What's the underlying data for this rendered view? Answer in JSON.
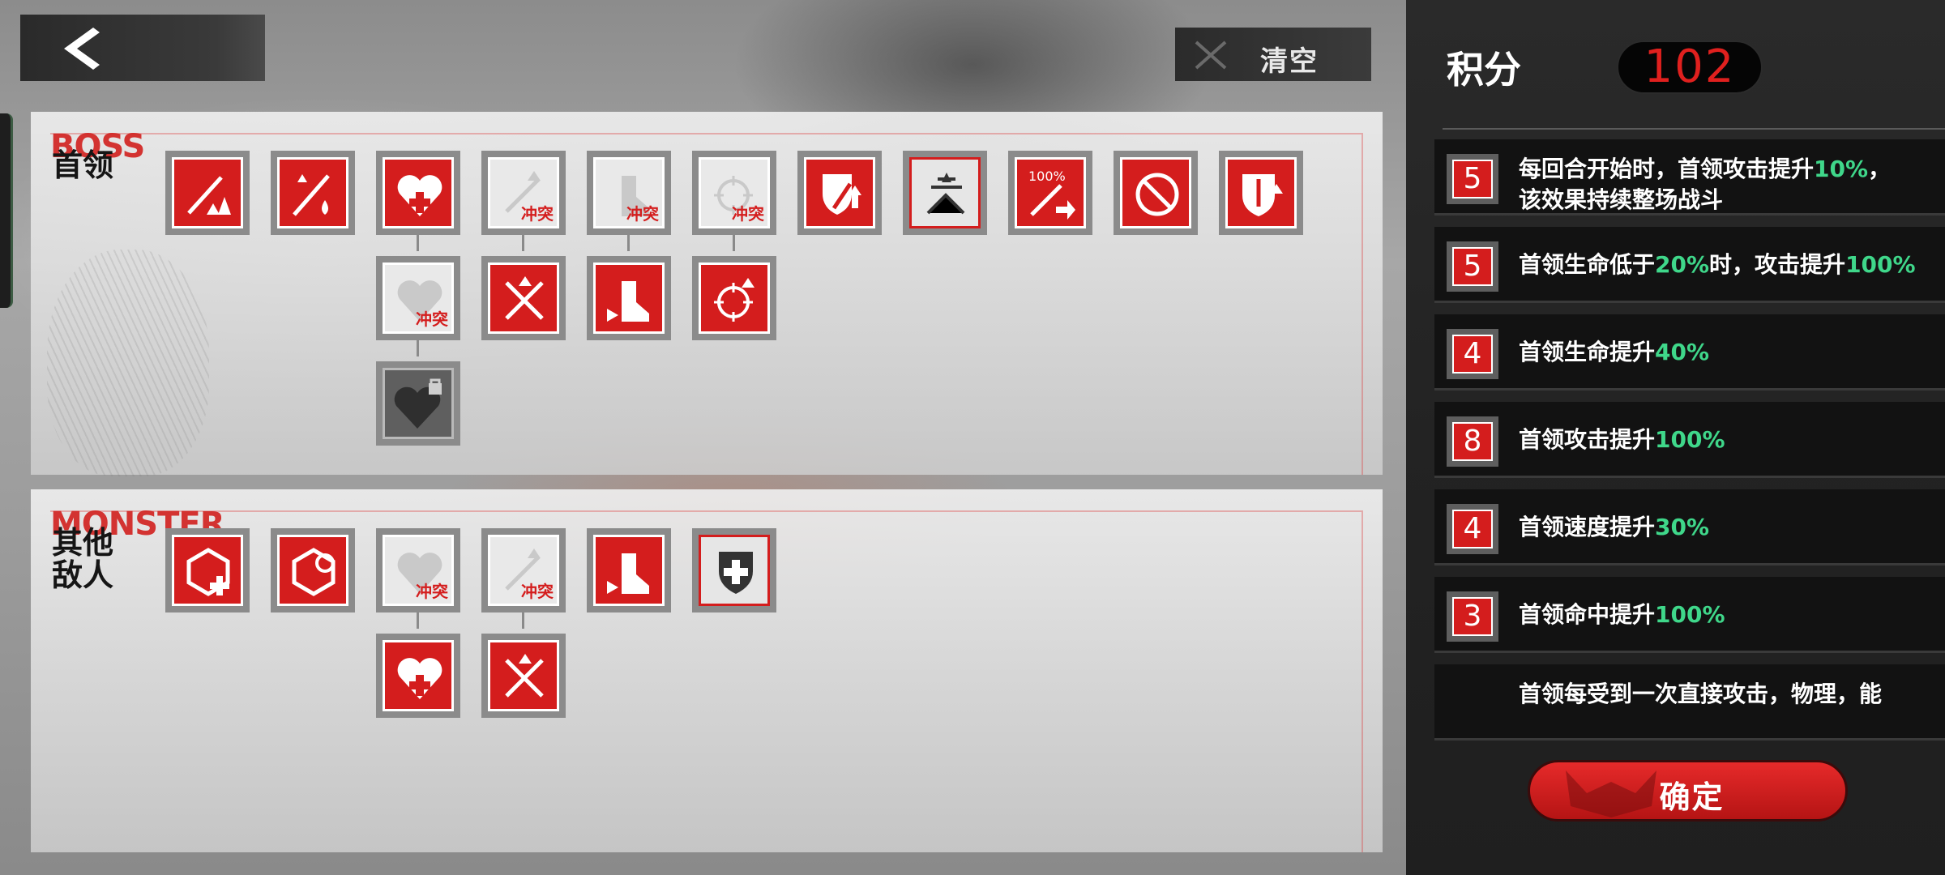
{
  "header": {
    "back_icon": "chevron-left-icon",
    "clear_label": "清空",
    "clear_icon": "x-icon"
  },
  "boss": {
    "title_en": "BOSS",
    "title_cn": "首领",
    "conflict_tag": "冲突"
  },
  "monster": {
    "title_en": "MONSTER",
    "title_cn": "其他敌人"
  },
  "colors": {
    "accent": "#d41d1d",
    "highlight": "#3fd78a",
    "sidebar_bg": "#232323"
  },
  "score": {
    "label": "积分",
    "value": "102"
  },
  "buffs": [
    {
      "cost": "5",
      "pre": "每回合开始时，首领攻击提升",
      "v1": "10%",
      "mid": "，",
      "line2": "该效果持续整场战斗"
    },
    {
      "cost": "5",
      "pre": "首领生命低于",
      "v1": "20%",
      "mid": "时，攻击提升",
      "v2": "100%"
    },
    {
      "cost": "4",
      "pre": "首领生命提升",
      "v1": "40%"
    },
    {
      "cost": "8",
      "pre": "首领攻击提升",
      "v1": "100%"
    },
    {
      "cost": "4",
      "pre": "首领速度提升",
      "v1": "30%"
    },
    {
      "cost": "3",
      "pre": "首领命中提升",
      "v1": "100%"
    },
    {
      "cost": "",
      "pre": "首领每受到一次直接攻击，物理，能"
    }
  ],
  "confirm_label": "确定"
}
